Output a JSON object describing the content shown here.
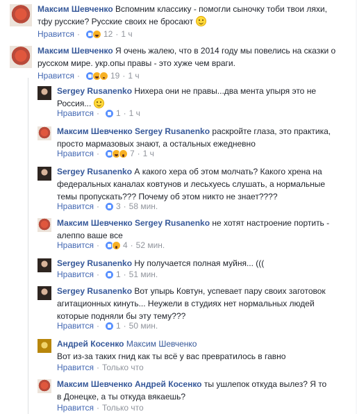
{
  "actions": {
    "like": "Нравится",
    "dot": "·"
  },
  "comments": [
    {
      "author": "Максим Шевченко",
      "mention": "",
      "text1": "Вспомним классику - помогли сыночку тоби твои ляхи,",
      "text2": "тфу русские? Русские своих не бросают",
      "reactions": [
        "like-icon",
        "haha-icon"
      ],
      "count": "12",
      "time": "1 ч",
      "avatar_color": "#a33b2a"
    },
    {
      "author": "Максим Шевченко",
      "mention": "",
      "text1": "Я очень жалею, что в 2014 году мы повелись на сказки о",
      "text2": "русском мире. укр.опы правы - это хуже чем враги.",
      "reactions": [
        "like-icon",
        "haha-icon",
        "sad-icon"
      ],
      "count": "19",
      "time": "1 ч",
      "avatar_color": "#a33b2a"
    },
    {
      "author": "Sergey Rusanenko",
      "mention": "",
      "text1": "Нихера они не правы...два мента упыря это не",
      "text2": "Россия...",
      "reactions": [
        "like-icon"
      ],
      "count": "1",
      "time": "1 ч",
      "avatar_color": "#4a3a30"
    },
    {
      "author": "Максим Шевченко",
      "mention": "Sergey Rusanenko",
      "text1": "раскройте глаза, это практика,",
      "text2": "просто мармазовых знают, а остальных ежедневно",
      "reactions": [
        "like-icon",
        "haha-icon",
        "wow-icon"
      ],
      "count": "7",
      "time": "1 ч",
      "avatar_color": "#a33b2a"
    },
    {
      "author": "Sergey Rusanenko",
      "mention": "",
      "text1": "А какого хера об этом молчать? Какого хрена на",
      "text2": "федеральных каналах ковтунов и лесьхуесь слушать, а нормальные",
      "text3": "темы пропускать??? Почему об этом никто не знает????",
      "reactions": [
        "like-icon"
      ],
      "count": "3",
      "time": "58 мин.",
      "avatar_color": "#4a3a30"
    },
    {
      "author": "Максим Шевченко",
      "mention": "Sergey Rusanenko",
      "text1": "не хотят настроение портить -",
      "text2": "алеппо ваше все",
      "reactions": [
        "like-icon",
        "wow-icon"
      ],
      "count": "4",
      "time": "52 мин.",
      "avatar_color": "#a33b2a"
    },
    {
      "author": "Sergey Rusanenko",
      "mention": "",
      "text1": "Ну получается полная муйня... (((",
      "reactions": [
        "like-icon"
      ],
      "count": "1",
      "time": "51 мин.",
      "avatar_color": "#4a3a30"
    },
    {
      "author": "Sergey Rusanenko",
      "mention": "",
      "text1": "Вот упырь Ковтун, успевает пару своих заготовок",
      "text2": "агитационных кинуть... Неужели в студиях нет нормальных людей",
      "text3": "которые подняли бы эту тему???",
      "reactions": [
        "like-icon"
      ],
      "count": "1",
      "time": "50 мин.",
      "avatar_color": "#4a3a30"
    },
    {
      "author": "Андрей Косенко",
      "mention": "Максим Шевченко",
      "text2": "Вот из-за таких гнид как ты всё у вас превратилось в гавно",
      "time": "Только что",
      "avatar_color": "#c9a233"
    },
    {
      "author": "Максим Шевченко",
      "mention": "Андрей Косенко",
      "text1": "ты ушлепок откуда вылез? Я то",
      "text2": "в Донецке, а ты откуда вякаешь?",
      "time": "Только что",
      "avatar_color": "#a33b2a"
    }
  ],
  "colors": {
    "link": "#365899",
    "meta": "#90949c",
    "like_blue": "#4267b2"
  }
}
